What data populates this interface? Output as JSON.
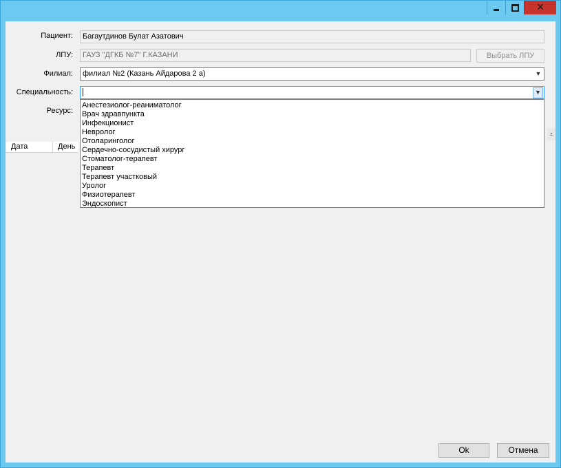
{
  "form": {
    "patient_label": "Пациент:",
    "patient_value": "Багаутдинов Булат Азатович",
    "lpu_label": "ЛПУ:",
    "lpu_value": "ГАУЗ \"ДГКБ №7\" Г.КАЗАНИ",
    "choose_lpu_button": "Выбрать ЛПУ",
    "branch_label": "Филиал:",
    "branch_value": "филиал №2 (Казань Айдарова 2 а)",
    "specialty_label": "Специальность:",
    "specialty_value": "",
    "resource_label": "Ресурс:"
  },
  "specialty_options": [
    "Анестезиолог-реаниматолог",
    "Врач здравпункта",
    "Инфекционист",
    "Невролог",
    "Отоларинголог",
    "Сердечно-сосудистый хирург",
    "Стоматолог-терапевт",
    "Терапевт",
    "Терапевт участковый",
    "Уролог",
    "Физиотерапевт",
    "Эндоскопист"
  ],
  "grid": {
    "columns": [
      "Дата",
      "День"
    ]
  },
  "buttons": {
    "ok": "Ok",
    "cancel": "Отмена"
  },
  "icons": {
    "minimize": "minimize-icon",
    "maximize": "maximize-icon",
    "close": "close-icon",
    "dropdown": "chevron-down-icon"
  },
  "colors": {
    "titlebar": "#6ccaf0",
    "close_button": "#c7342c",
    "client_bg": "#f0f0f0"
  }
}
